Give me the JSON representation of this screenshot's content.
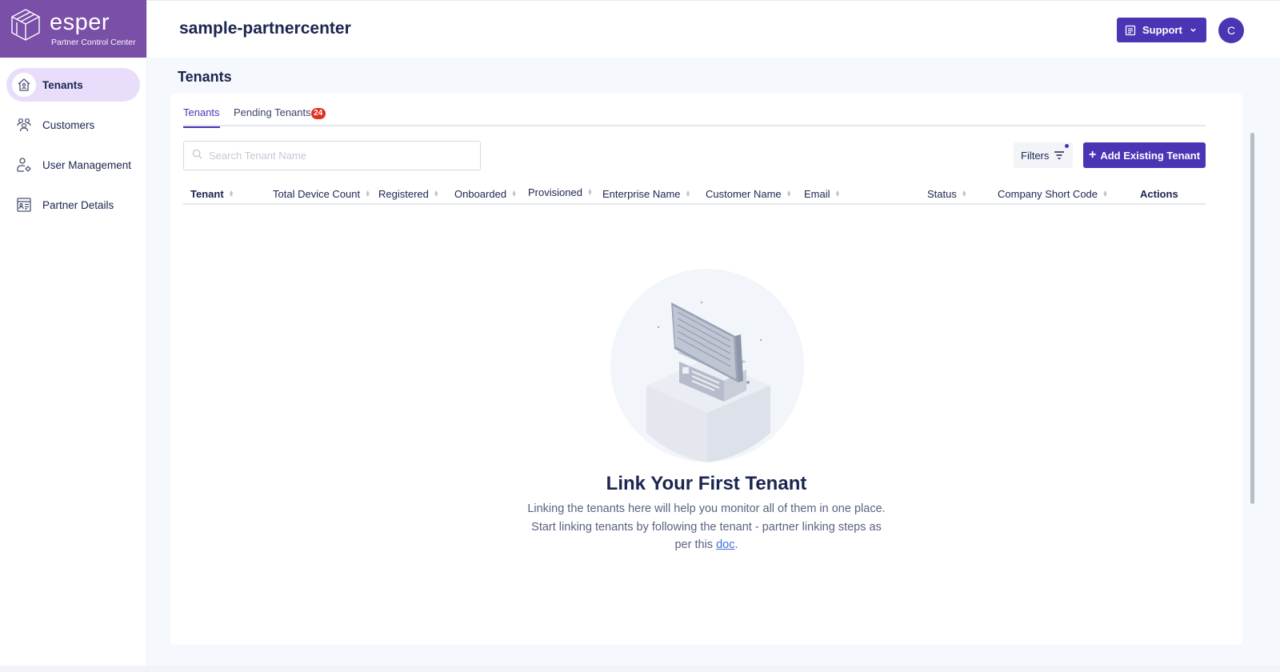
{
  "brand": {
    "name": "esper",
    "subtitle": "Partner Control Center"
  },
  "header": {
    "org_name": "sample-partnercenter",
    "support_label": "Support",
    "avatar_initial": "C"
  },
  "sidebar": {
    "items": [
      {
        "label": "Tenants",
        "icon": "home-icon",
        "active": true
      },
      {
        "label": "Customers",
        "icon": "users-icon",
        "active": false
      },
      {
        "label": "User Management",
        "icon": "user-settings-icon",
        "active": false
      },
      {
        "label": "Partner Details",
        "icon": "id-card-icon",
        "active": false
      }
    ]
  },
  "page": {
    "title": "Tenants"
  },
  "tabs": [
    {
      "label": "Tenants",
      "active": true
    },
    {
      "label": "Pending Tenants",
      "badge": "24",
      "active": false
    }
  ],
  "search": {
    "placeholder": "Search Tenant Name",
    "value": ""
  },
  "toolbar": {
    "filters_label": "Filters",
    "add_label": "Add Existing Tenant"
  },
  "table": {
    "columns": [
      "Tenant",
      "Total Device Count",
      "Registered",
      "Onboarded",
      "Provisioned",
      "Enterprise Name",
      "Customer Name",
      "Email",
      "Status",
      "Company Short Code",
      "Actions"
    ],
    "rows": []
  },
  "empty_state": {
    "title": "Link Your First Tenant",
    "line1": "Linking the tenants here will help you monitor all of them in one place.",
    "line2": "Start linking tenants by following the tenant - partner linking steps as",
    "line3_prefix": "per this",
    "link_text": "doc",
    "line3_suffix": "."
  },
  "colors": {
    "brand": "#7a4fa8",
    "primary": "#4c35b5",
    "badge": "#e0301e",
    "active_nav": "#e8defc"
  }
}
